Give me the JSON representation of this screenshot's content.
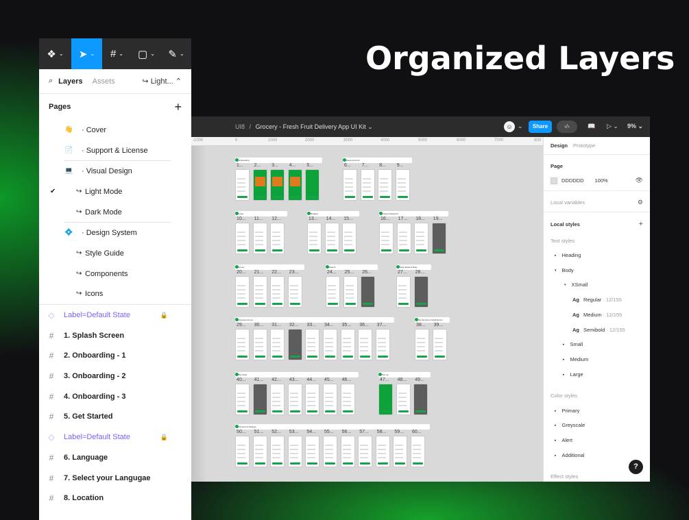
{
  "hero_title": "Organized Layers",
  "layers_panel": {
    "tabs": {
      "layers": "Layers",
      "assets": "Assets",
      "page_switch": "Light..."
    },
    "pages_heading": "Pages",
    "pages": [
      {
        "icon": "👋",
        "label": "· Cover"
      },
      {
        "icon": "📄",
        "label": "· Support & License"
      },
      {
        "icon": "💻",
        "label": "· Visual Design"
      },
      {
        "icon": "↪",
        "label": "Light Mode",
        "checked": true
      },
      {
        "icon": "↪",
        "label": "Dark Mode"
      },
      {
        "icon": "💠",
        "label": "· Design System"
      },
      {
        "icon": "↪",
        "label": "Style Guide"
      },
      {
        "icon": "↪",
        "label": "Components"
      },
      {
        "icon": "↪",
        "label": "Icons"
      }
    ],
    "layers": [
      {
        "label": "Label=Default State",
        "kind": "component"
      },
      {
        "label": "1. Splash Screen",
        "kind": "frame"
      },
      {
        "label": "2. Onboarding - 1",
        "kind": "frame"
      },
      {
        "label": "3. Onboarding - 2",
        "kind": "frame"
      },
      {
        "label": "4. Onboarding - 3",
        "kind": "frame"
      },
      {
        "label": "5. Get Started",
        "kind": "frame"
      },
      {
        "label": "Label=Default State",
        "kind": "component"
      },
      {
        "label": "6. Language",
        "kind": "frame"
      },
      {
        "label": "7. Select your Langugae",
        "kind": "frame"
      },
      {
        "label": "8. Location",
        "kind": "frame"
      }
    ]
  },
  "app": {
    "breadcrumb_folder": "UI8",
    "breadcrumb_sep": "/",
    "file_name": "Grocery - Fresh Fruit Delivery App UI Kit",
    "share_label": "Share",
    "zoom": "9%",
    "ruler_marks": [
      "-1000",
      "0",
      "1000",
      "2000",
      "3000",
      "4000",
      "5000",
      "6000",
      "7000",
      "800"
    ],
    "canvas_groups": [
      {
        "title": "Onboarding",
        "numbers": [
          "1...",
          "2...",
          "3...",
          "4...",
          "5..."
        ]
      },
      {
        "title": "Setup Account",
        "numbers": [
          "6...",
          "7...",
          "8...",
          "9..."
        ]
      },
      {
        "title": "Login",
        "numbers": [
          "10...",
          "11...",
          "12..."
        ]
      },
      {
        "title": "Register",
        "numbers": [
          "13...",
          "14...",
          "15..."
        ]
      },
      {
        "title": "Forgot Password",
        "numbers": [
          "16...",
          "17...",
          "18...",
          "19..."
        ]
      },
      {
        "title": "Home",
        "numbers": [
          "20...",
          "21...",
          "22...",
          "23..."
        ]
      },
      {
        "title": "Search",
        "numbers": [
          "24...",
          "25...",
          "26..."
        ]
      },
      {
        "title": "Shop Detail & Rate",
        "numbers": [
          "27...",
          "28..."
        ]
      },
      {
        "title": "Checkout Items",
        "numbers": [
          "29...",
          "30...",
          "31...",
          "32...",
          "33...",
          "34...",
          "35...",
          "36...",
          "37..."
        ]
      },
      {
        "title": "My Favorite & Notifications",
        "numbers": [
          "38...",
          "39..."
        ]
      },
      {
        "title": "My Order",
        "numbers": [
          "40...",
          "41...",
          "42...",
          "43...",
          "44...",
          "45...",
          "46..."
        ]
      },
      {
        "title": "Top Up",
        "numbers": [
          "47...",
          "48...",
          "49..."
        ]
      },
      {
        "title": "Account & Settings",
        "numbers": [
          "50...",
          "51...",
          "52...",
          "53...",
          "54...",
          "55...",
          "56...",
          "57...",
          "58...",
          "59...",
          "60..."
        ]
      }
    ]
  },
  "design_panel": {
    "tab_design": "Design",
    "tab_prototype": "Prototype",
    "page_heading": "Page",
    "page_color": "DDDDDD",
    "page_opacity": "100%",
    "local_variables": "Local variables",
    "local_styles": "Local styles",
    "text_styles": "Text styles",
    "heading": "Heading",
    "body": "Body",
    "xsmall": "XSmall",
    "ag": "Ag",
    "regular": "Regular",
    "regular_meta": "· 12/155",
    "medium_w": "Medium",
    "medium_meta": "· 12/155",
    "semibold": "Semibold",
    "semibold_meta": "· 12/155",
    "small": "Small",
    "medium": "Medium",
    "large": "Large",
    "color_styles": "Color styles",
    "primary": "Primary",
    "greyscale": "Greyscale",
    "alert": "Alert",
    "additional": "Additional",
    "effect_styles": "Effect styles"
  },
  "help_label": "?",
  "colors": {
    "accent": "#0d99ff",
    "brand_green": "#17a34a",
    "component_purple": "#7b61ff"
  }
}
